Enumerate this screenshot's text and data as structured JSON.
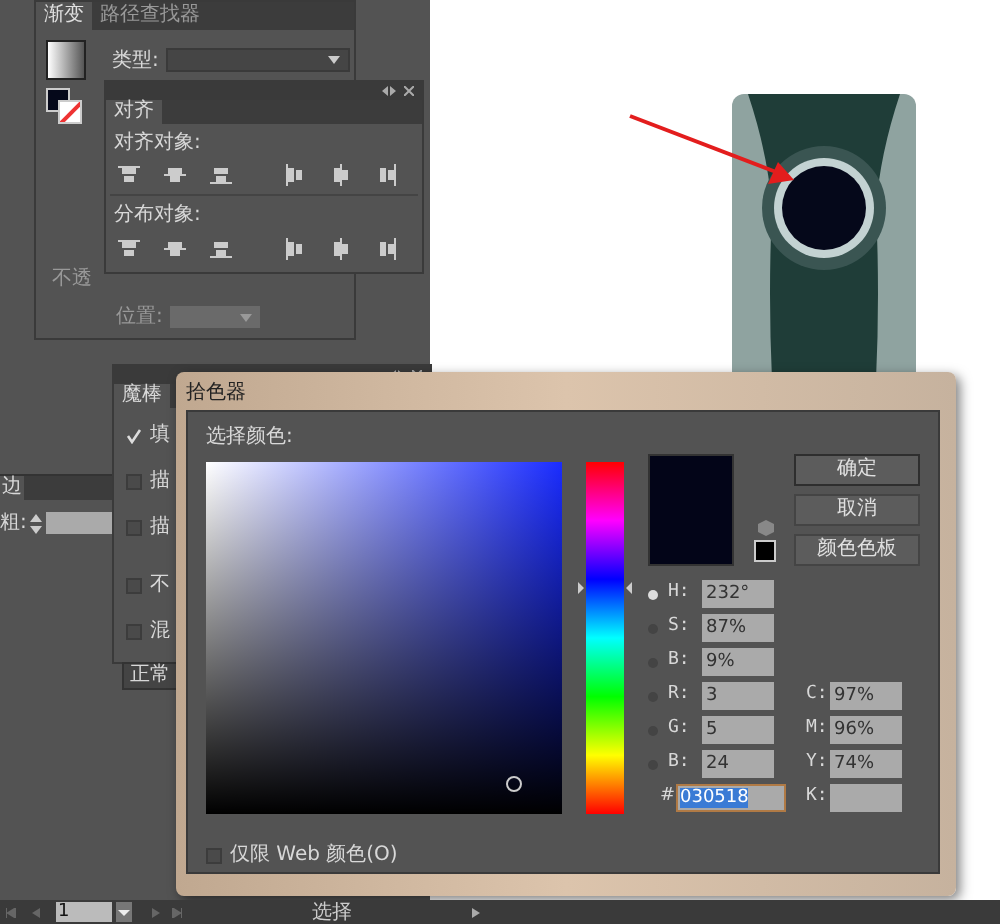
{
  "gradient_panel": {
    "tabs": [
      {
        "label": "渐变",
        "selected": true
      },
      {
        "label": "路径查找器",
        "selected": false
      }
    ],
    "type_label": "类型:",
    "opacity_label": "不透",
    "position_label": "位置:"
  },
  "align_panel": {
    "tab": "对齐",
    "align_label": "对齐对象:",
    "distribute_label": "分布对象:"
  },
  "appearance_panel": {
    "tab": "魔棒",
    "options": [
      {
        "label": "填",
        "checked": true
      },
      {
        "label": "描",
        "checked": false
      },
      {
        "label": "描",
        "checked": false
      },
      {
        "label": "不",
        "checked": false
      },
      {
        "label": "混",
        "checked": false
      }
    ],
    "blend_button": "正常"
  },
  "stroke_panel": {
    "tab": "边",
    "weight_label": "粗:"
  },
  "color_picker": {
    "title": "拾色器",
    "prompt": "选择颜色:",
    "buttons": [
      "确定",
      "取消",
      "颜色色板"
    ],
    "fields": [
      {
        "label": "H:",
        "value": "232°",
        "selected": true
      },
      {
        "label": "S:",
        "value": "87%",
        "selected": false
      },
      {
        "label": "B:",
        "value": "9%",
        "selected": false
      },
      {
        "label": "R:",
        "value": "3",
        "selected": false
      },
      {
        "label": "G:",
        "value": "5",
        "selected": false
      },
      {
        "label": "B:",
        "value": "24",
        "selected": false
      }
    ],
    "cmyk": [
      {
        "label": "C:",
        "value": "97%"
      },
      {
        "label": "M:",
        "value": "96%"
      },
      {
        "label": "Y:",
        "value": "74%"
      },
      {
        "label": "K:"
      }
    ],
    "hex_label": "#",
    "hex": "030518",
    "web_only": {
      "label": "仅限 Web 颜色(O)",
      "checked": false
    }
  },
  "status_bar": {
    "page": "1",
    "tool": "选择"
  }
}
